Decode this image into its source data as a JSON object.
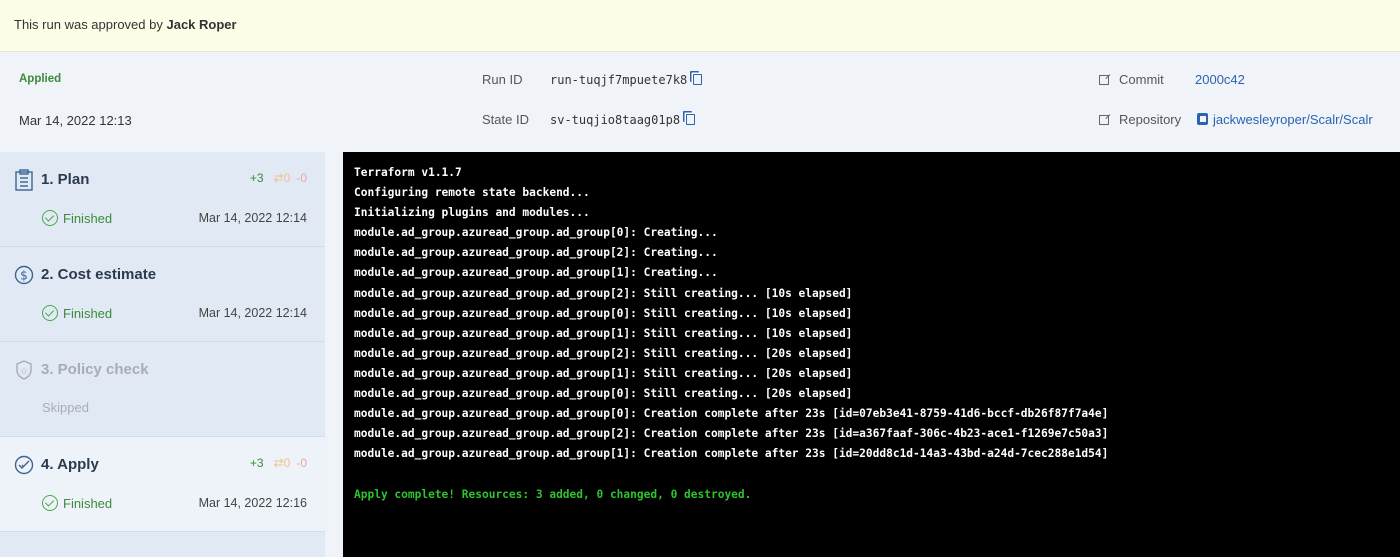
{
  "banner": {
    "prefix": "This run was approved by",
    "user": "Jack Roper"
  },
  "run": {
    "status": "Applied",
    "date": "Mar 14, 2022 12:13",
    "run_id_label": "Run ID",
    "run_id": "run-tuqjf7mpuete7k8",
    "state_id_label": "State ID",
    "state_id": "sv-tuqjio8taag01p8",
    "commit_label": "Commit",
    "commit": "2000c42",
    "repo_label": "Repository",
    "repo": "jackwesleyroper/Scalr/Scalr"
  },
  "steps": [
    {
      "title": "1. Plan",
      "status": "Finished",
      "time": "Mar 14, 2022 12:14",
      "add": "+3",
      "change": "⇄0",
      "destroy": "-0"
    },
    {
      "title": "2. Cost estimate",
      "status": "Finished",
      "time": "Mar 14, 2022 12:14"
    },
    {
      "title": "3. Policy check",
      "status": "Skipped"
    },
    {
      "title": "4. Apply",
      "status": "Finished",
      "time": "Mar 14, 2022 12:16",
      "add": "+3",
      "change": "⇄0",
      "destroy": "-0"
    }
  ],
  "log": [
    "Terraform v1.1.7",
    "Configuring remote state backend...",
    "Initializing plugins and modules...",
    "module.ad_group.azuread_group.ad_group[0]: Creating...",
    "module.ad_group.azuread_group.ad_group[2]: Creating...",
    "module.ad_group.azuread_group.ad_group[1]: Creating...",
    "module.ad_group.azuread_group.ad_group[2]: Still creating... [10s elapsed]",
    "module.ad_group.azuread_group.ad_group[0]: Still creating... [10s elapsed]",
    "module.ad_group.azuread_group.ad_group[1]: Still creating... [10s elapsed]",
    "module.ad_group.azuread_group.ad_group[2]: Still creating... [20s elapsed]",
    "module.ad_group.azuread_group.ad_group[1]: Still creating... [20s elapsed]",
    "module.ad_group.azuread_group.ad_group[0]: Still creating... [20s elapsed]",
    "module.ad_group.azuread_group.ad_group[0]: Creation complete after 23s [id=07eb3e41-8759-41d6-bccf-db26f87f7a4e]",
    "module.ad_group.azuread_group.ad_group[2]: Creation complete after 23s [id=a367faaf-306c-4b23-ace1-f1269e7c50a3]",
    "module.ad_group.azuread_group.ad_group[1]: Creation complete after 23s [id=20dd8c1d-14a3-43bd-a24d-7cec288e1d54]",
    ""
  ],
  "log_summary": "Apply complete! Resources: 3 added, 0 changed, 0 destroyed."
}
